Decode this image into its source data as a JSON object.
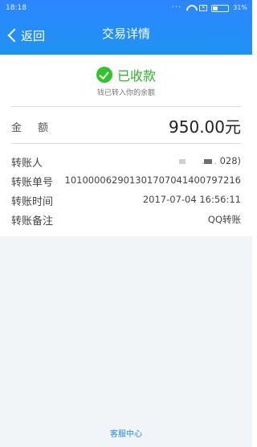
{
  "status_bar": {
    "time": "18:18",
    "battery": "31%"
  },
  "navbar": {
    "back_label": "返回",
    "title": "交易详情"
  },
  "result": {
    "status": "已收款",
    "subtitle": "钱已转入你的余额"
  },
  "amount": {
    "label": "金额",
    "value": "950.00元"
  },
  "details": [
    {
      "label": "转账人",
      "value": "028)"
    },
    {
      "label": "转账单号",
      "value": "101000062901301707041400797216"
    },
    {
      "label": "转账时间",
      "value": "2017-07-04 16:56:11"
    },
    {
      "label": "转账备注",
      "value": "QQ转账"
    }
  ],
  "footer": {
    "service_link": "客服中心"
  },
  "colors": {
    "header": "#2d86ff",
    "success": "#33c32f",
    "link": "#1f8de8"
  }
}
